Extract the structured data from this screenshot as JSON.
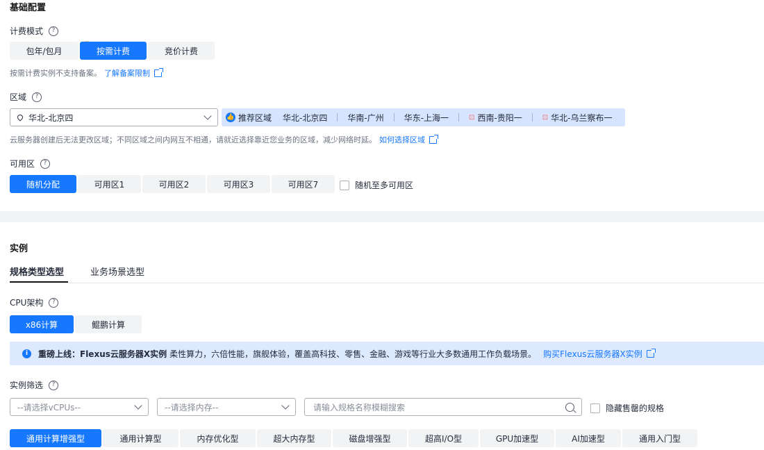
{
  "basic": {
    "title": "基础配置",
    "billing": {
      "label": "计费模式",
      "options": [
        "包年/包月",
        "按需计费",
        "竞价计费"
      ],
      "hint": "按需计费实例不支持备案。",
      "hint_link": "了解备案限制"
    },
    "region": {
      "label": "区域",
      "selected": "华北-北京四",
      "recommend_label": "推荐区域",
      "recommended": [
        "华北-北京四",
        "华南-广州",
        "华东-上海一",
        "西南-贵阳一",
        "华北-乌兰察布一"
      ],
      "hint": "云服务器创建后无法更改区域；不同区域之间内网互不相通，请就近选择靠近您业务的区域，减少网络时延。",
      "hint_link": "如何选择区域"
    },
    "az": {
      "label": "可用区",
      "options": [
        "随机分配",
        "可用区1",
        "可用区2",
        "可用区3",
        "可用区7"
      ],
      "checkbox_label": "随机至多可用区"
    }
  },
  "instance": {
    "title": "实例",
    "tabs": [
      "规格类型选型",
      "业务场景选型"
    ],
    "cpu": {
      "label": "CPU架构",
      "options": [
        "x86计算",
        "鲲鹏计算"
      ]
    },
    "notice": {
      "strong": "重磅上线：Flexus云服务器X实例",
      "text": "柔性算力，六倍性能，旗舰体验，覆盖高科技、零售、金融、游戏等行业大多数通用工作负载场景。",
      "link": "购买Flexus云服务器X实例"
    },
    "filter": {
      "label": "实例筛选",
      "vcpu_placeholder": "--请选择vCPUs--",
      "mem_placeholder": "--请选择内存--",
      "search_placeholder": "请输入规格名称模糊搜索",
      "hide_soldout": "隐藏售罄的规格"
    },
    "types": [
      "通用计算增强型",
      "通用计算型",
      "内存优化型",
      "超大内存型",
      "磁盘增强型",
      "超高I/O型",
      "GPU加速型",
      "AI加速型",
      "通用入门型"
    ]
  },
  "colors": {
    "primary": "#1677ff",
    "region_bg": "#d6e4ff",
    "notice_bg": "#dce9ff",
    "divider": "#f2f3f5"
  }
}
